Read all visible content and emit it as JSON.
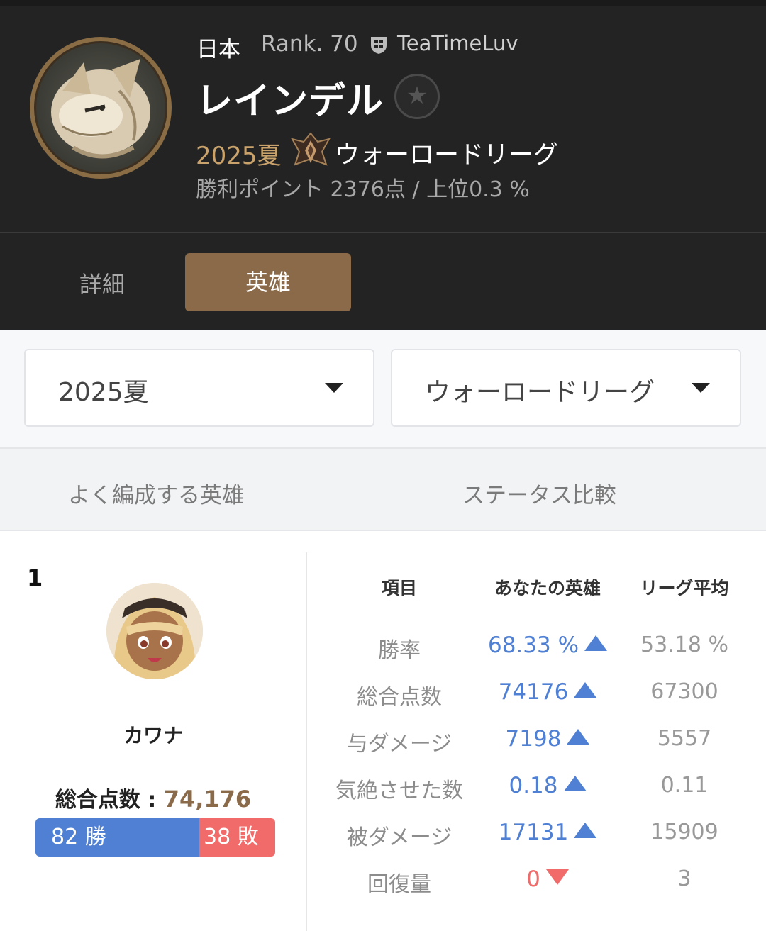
{
  "profile": {
    "region": "日本",
    "rank": "Rank. 70",
    "guild_icon": "guild-crest-icon",
    "guild": "TeaTimeLuv",
    "name": "レインデル",
    "favorite_icon": "star-icon",
    "season": "2025夏",
    "league_icon": "warlord-emblem-icon",
    "league": "ウォーロードリーグ",
    "points": "勝利ポイント 2376点 / 上位0.3 %"
  },
  "tabs": {
    "detail": "詳細",
    "hero": "英雄",
    "active": "英雄"
  },
  "filters": {
    "season": "2025夏",
    "league": "ウォーロードリーグ",
    "caret_icon": "caret-down-icon"
  },
  "subnav": {
    "frequent": "よく編成する英雄",
    "compare": "ステータス比較"
  },
  "hero_card": {
    "rank": "1",
    "name": "カワナ",
    "score_label": "総合点数 : ",
    "score": "74,176",
    "wins": "82 勝",
    "losses": "38 敗",
    "win_count": 82,
    "loss_count": 38
  },
  "stats": {
    "headers": [
      "項目",
      "あなたの英雄",
      "リーグ平均"
    ],
    "rows": [
      {
        "label": "勝率",
        "value": "68.33 %",
        "trend": "up",
        "avg": "53.18 %"
      },
      {
        "label": "総合点数",
        "value": "74176",
        "trend": "up",
        "avg": "67300"
      },
      {
        "label": "与ダメージ",
        "value": "7198",
        "trend": "up",
        "avg": "5557"
      },
      {
        "label": "気絶させた数",
        "value": "0.18",
        "trend": "up",
        "avg": "0.11"
      },
      {
        "label": "被ダメージ",
        "value": "17131",
        "trend": "up",
        "avg": "15909"
      },
      {
        "label": "回復量",
        "value": "0",
        "trend": "down",
        "avg": "3"
      }
    ]
  },
  "colors": {
    "accent": "#8a6a49",
    "win": "#4f80d4",
    "loss": "#f26b6b",
    "header_bg": "#232323"
  }
}
